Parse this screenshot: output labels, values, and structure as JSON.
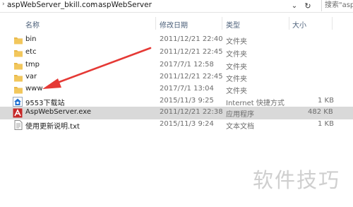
{
  "address_bar": {
    "breadcrumbs": [
      "aspWebServer_bkill.com",
      "aspWebServer"
    ],
    "search_placeholder": "搜索\"asp"
  },
  "columns": [
    "名称",
    "修改日期",
    "类型",
    "大小"
  ],
  "files": [
    {
      "name": "bin",
      "date": "2011/12/21 22:40",
      "type": "文件夹",
      "size": "",
      "icon": "folder-icon"
    },
    {
      "name": "etc",
      "date": "2011/12/21 22:45",
      "type": "文件夹",
      "size": "",
      "icon": "folder-icon"
    },
    {
      "name": "tmp",
      "date": "2017/7/1 12:58",
      "type": "文件夹",
      "size": "",
      "icon": "folder-icon"
    },
    {
      "name": "var",
      "date": "2011/12/21 22:45",
      "type": "文件夹",
      "size": "",
      "icon": "folder-icon"
    },
    {
      "name": "www",
      "date": "2017/7/1 13:04",
      "type": "文件夹",
      "size": "",
      "icon": "folder-icon"
    },
    {
      "name": "9553下载站",
      "date": "2015/11/3 9:25",
      "type": "Internet 快捷方式",
      "size": "1 KB",
      "icon": "internet-shortcut-icon"
    },
    {
      "name": "AspWebServer.exe",
      "date": "2011/12/21 22:38",
      "type": "应用程序",
      "size": "482 KB",
      "icon": "application-icon",
      "selected": true
    },
    {
      "name": "使用更新说明.txt",
      "date": "2015/11/3 9:24",
      "type": "文本文档",
      "size": "1 KB",
      "icon": "text-document-icon"
    }
  ],
  "watermark": "软件技巧",
  "colors": {
    "folder": "#e8b84a",
    "selection": "#d9d9d9",
    "arrow": "#e53935",
    "header_text": "#4c607a"
  }
}
